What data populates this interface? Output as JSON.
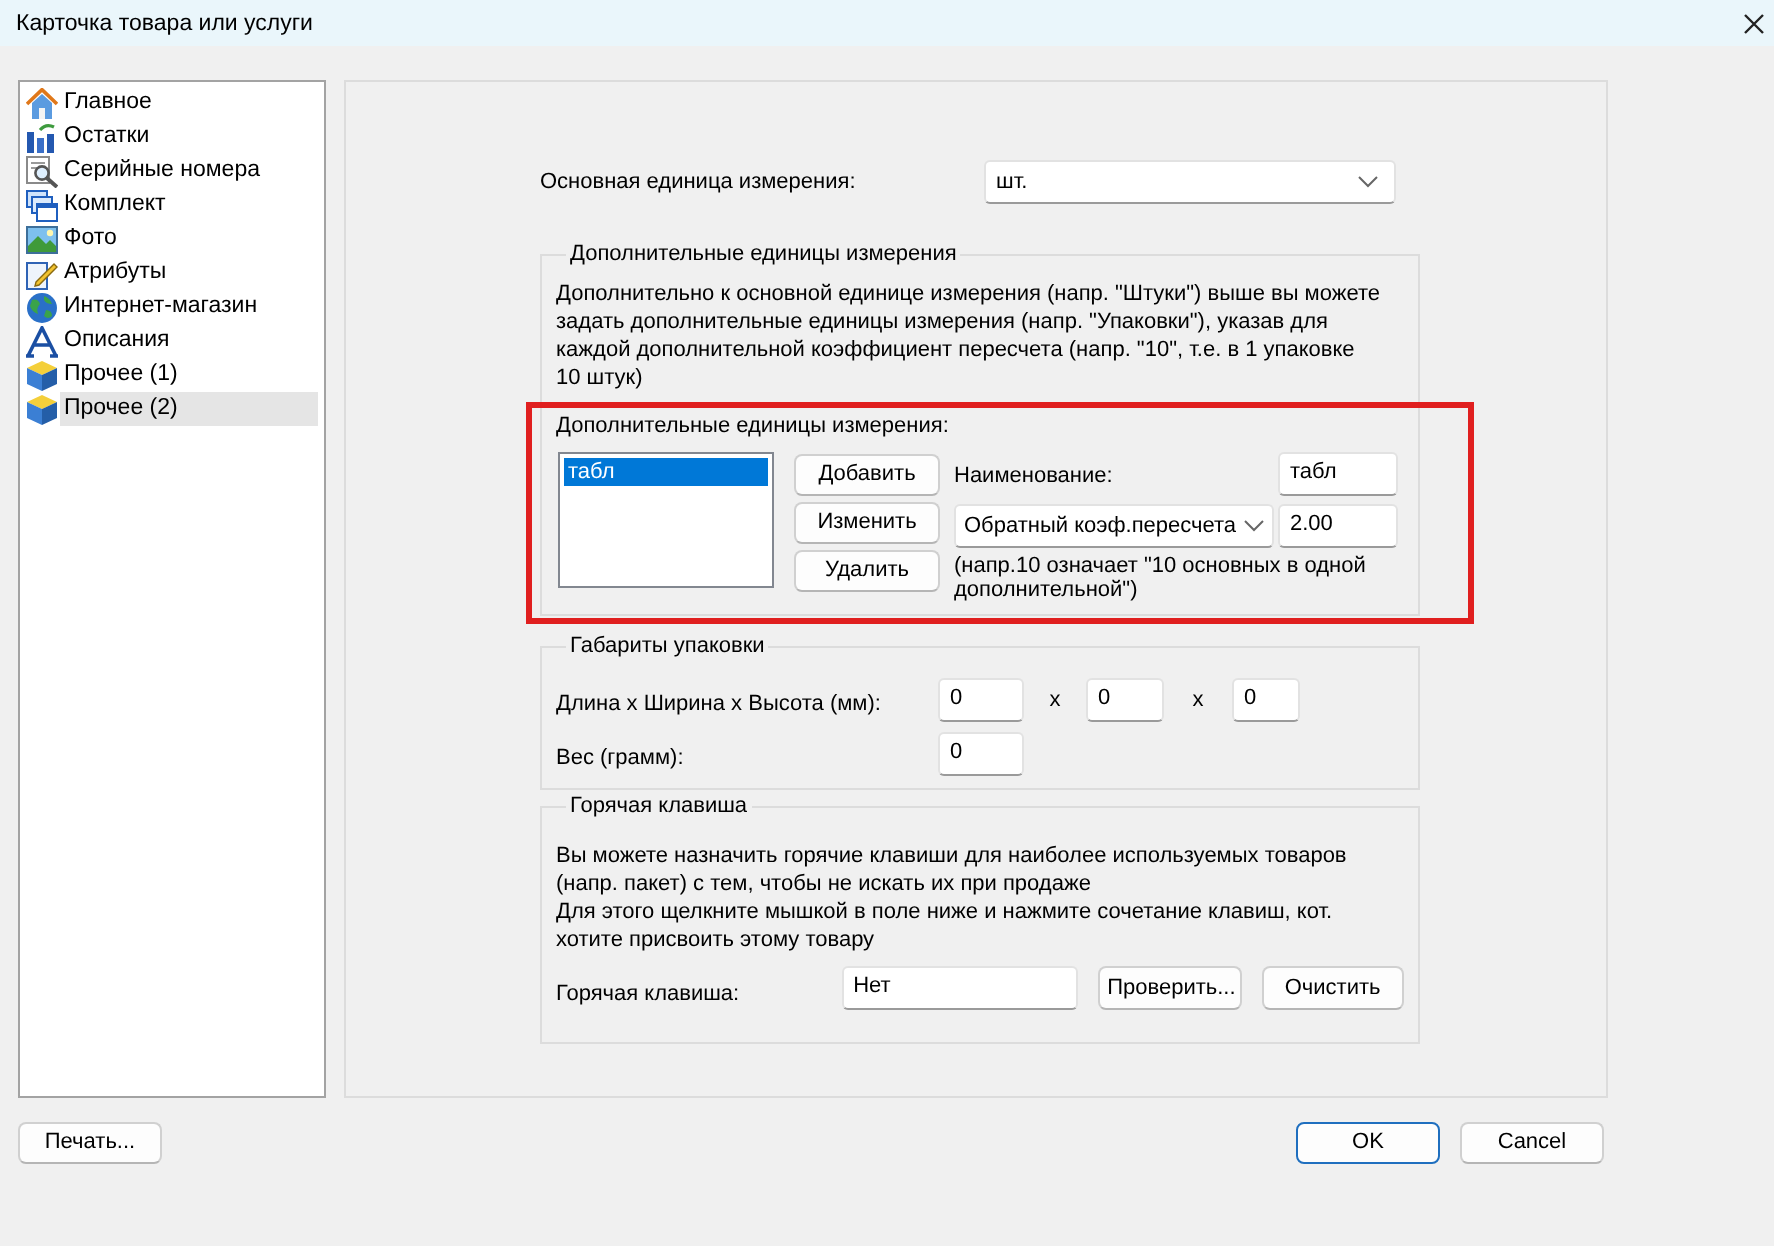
{
  "window": {
    "title": "Карточка товара или услуги"
  },
  "sidebar": {
    "items": [
      {
        "label": "Главное",
        "selected": false
      },
      {
        "label": "Остатки",
        "selected": false
      },
      {
        "label": "Серийные номера",
        "selected": false
      },
      {
        "label": "Комплект",
        "selected": false
      },
      {
        "label": "Фото",
        "selected": false
      },
      {
        "label": "Атрибуты",
        "selected": false
      },
      {
        "label": "Интернет-магазин",
        "selected": false
      },
      {
        "label": "Описания",
        "selected": false
      },
      {
        "label": "Прочее (1)",
        "selected": false
      },
      {
        "label": "Прочее (2)",
        "selected": true
      }
    ]
  },
  "base_unit": {
    "label": "Основная единица измерения:",
    "value": "шт."
  },
  "extra_units": {
    "title": "Дополнительные единицы измерения",
    "description": "Дополнительно к основной единице измерения (напр. \"Штуки\") выше вы можете\nзадать дополнительные единицы измерения (напр. \"Упаковки\"), указав для\nкаждой дополнительной коэффициент пересчета (напр. \"10\", т.е. в 1 упаковке\n10 штук)",
    "highlighted": true,
    "list_label": "Дополнительные единицы измерения:",
    "units": [
      {
        "label": "табл",
        "selected": true
      }
    ],
    "buttons": [
      "Добавить",
      "Изменить",
      "Удалить"
    ],
    "name_label": "Наименование:",
    "name_value": "табл",
    "factor_type": "Обратный коэф.пересчета",
    "factor_value": "2.00",
    "hint": "(напр.10 означает \"10 основных в одной\nдополнительной\")"
  },
  "dimensions": {
    "title": "Габариты упаковки",
    "size_label": "Длина х Ширина х Высота (мм):",
    "size_values": [
      "0",
      "0",
      "0"
    ],
    "separators": [
      "x",
      "x"
    ],
    "weight_label": "Вес (грамм):",
    "weight_value": "0"
  },
  "hotkey": {
    "title": "Горячая клавиша",
    "description": [
      "Вы можете назначить горячие клавиши для наиболее используемых товаров\n(напр. пакет) с тем, чтобы не искать их при продаже",
      "Для этого щелкните мышкой в поле ниже и нажмите сочетание клавиш, кот.\nхотите присвоить этому товару"
    ],
    "label": "Горячая клавиша:",
    "value": "Нет",
    "buttons": [
      "Проверить...",
      "Очистить"
    ]
  },
  "footer": {
    "buttons": [
      {
        "label": "Печать...",
        "default": false
      },
      {
        "label": "OK",
        "default": true
      },
      {
        "label": "Cancel",
        "default": false
      }
    ]
  }
}
